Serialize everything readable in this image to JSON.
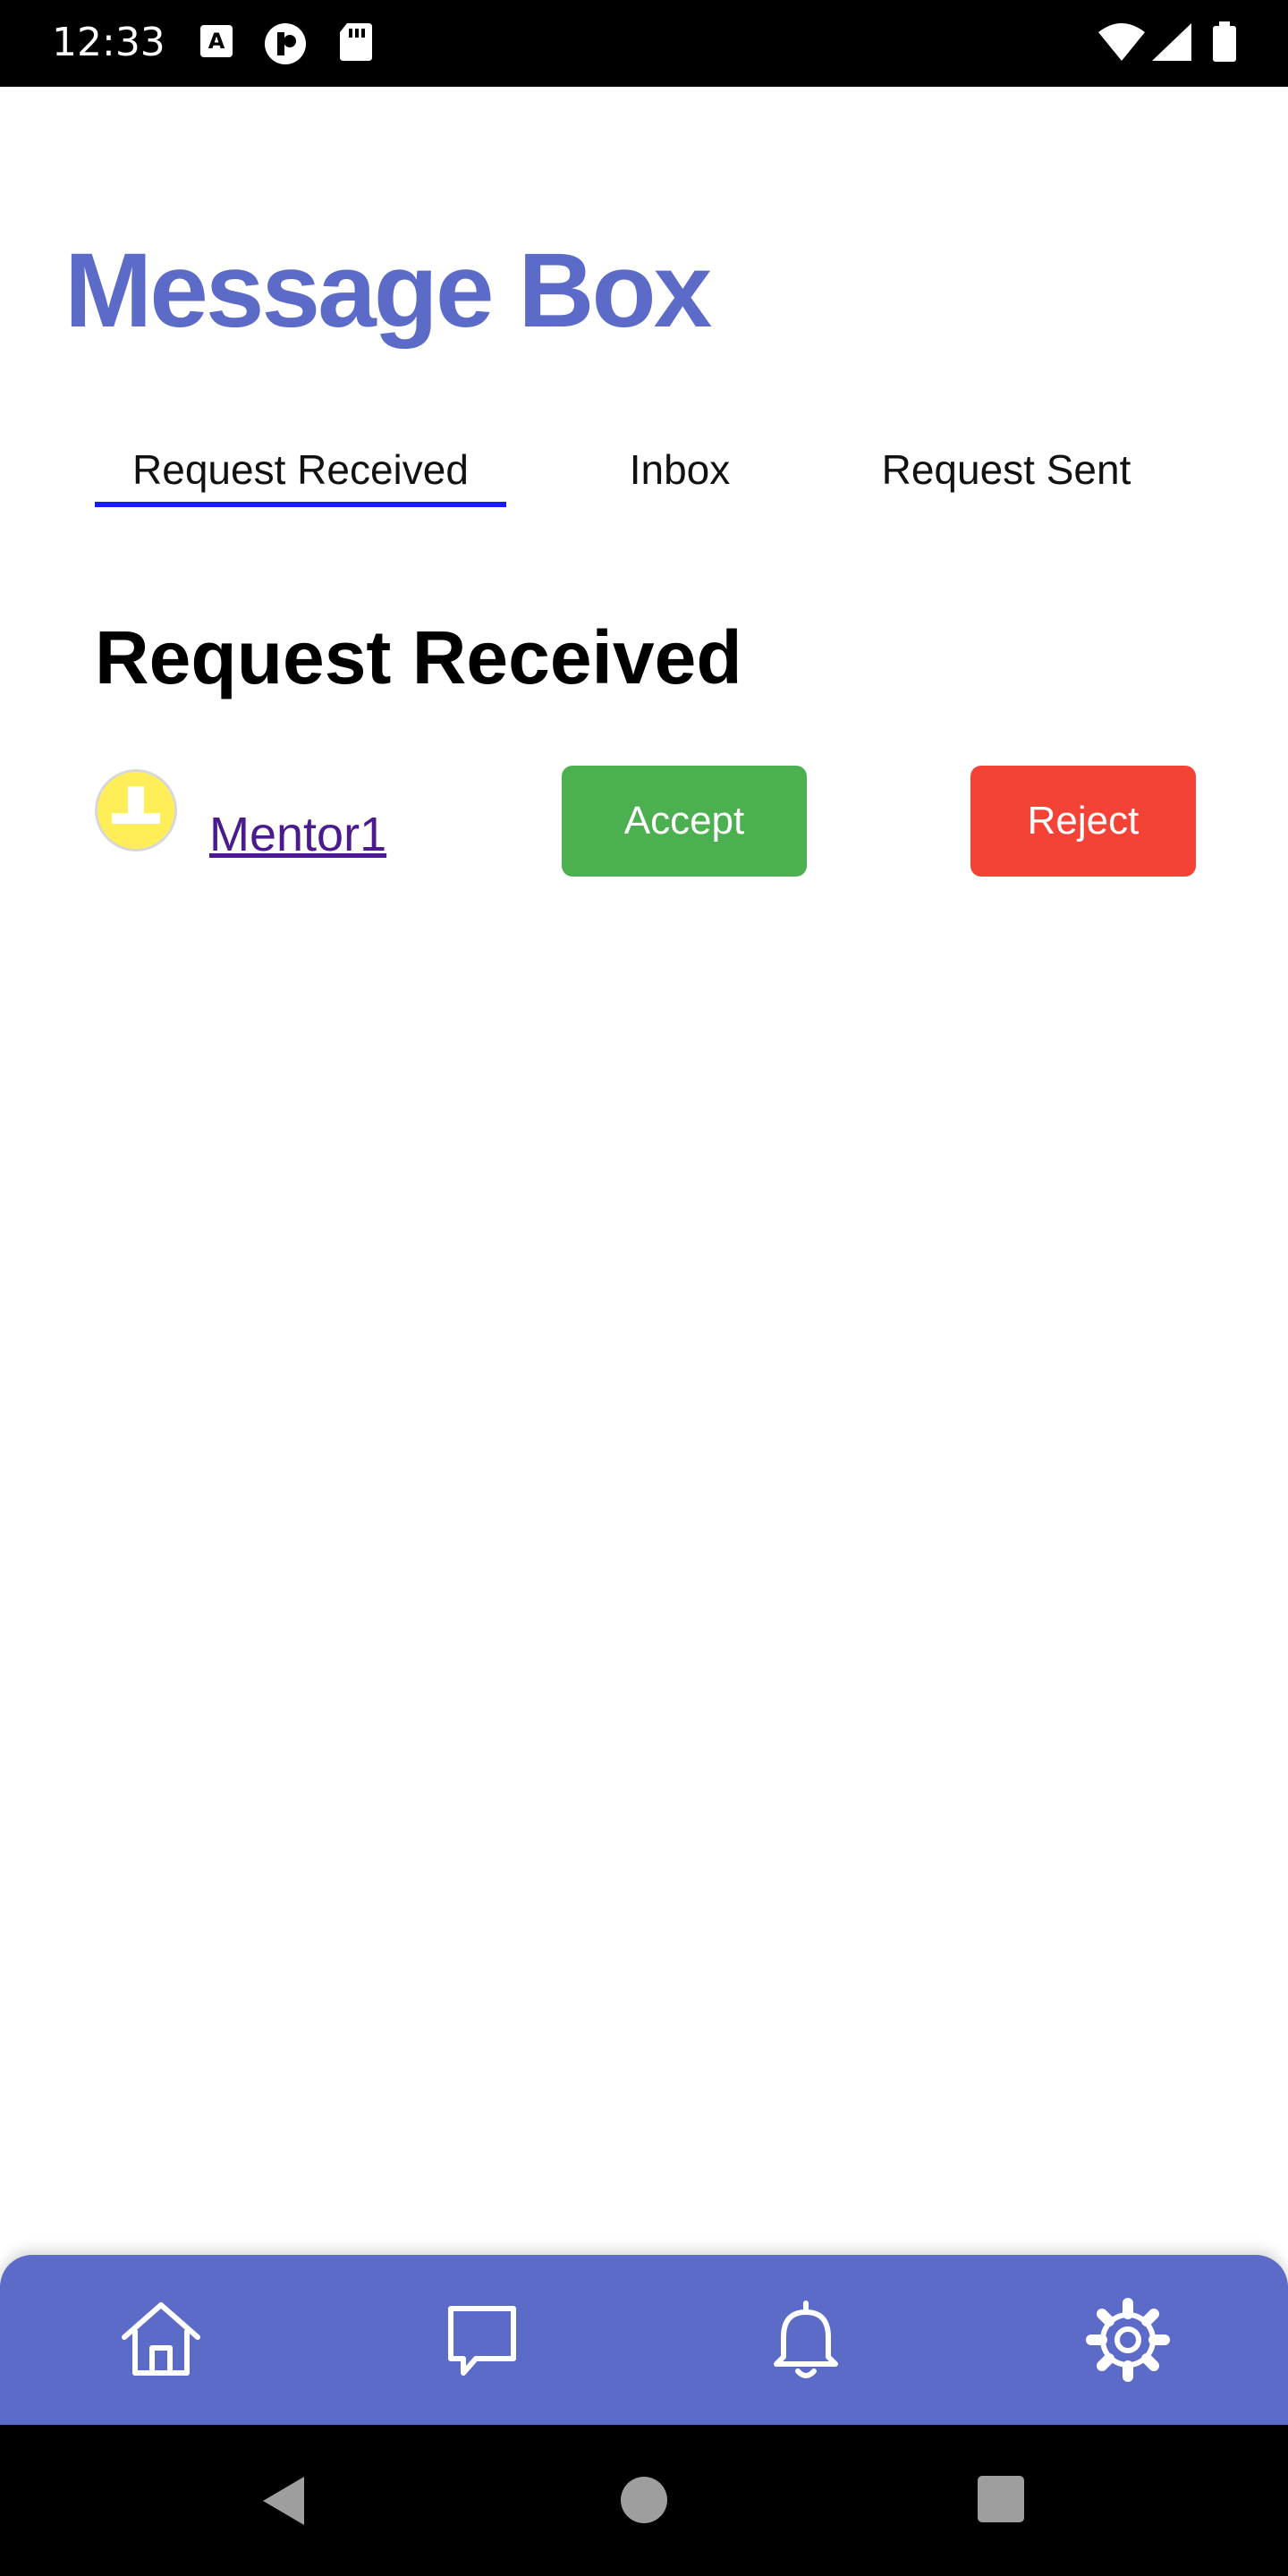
{
  "status_bar": {
    "time": "12:33",
    "left_icons": [
      "a11y-font-icon",
      "app-circle-icon",
      "sd-card-icon"
    ],
    "right_icons": [
      "wifi-icon",
      "signal-icon",
      "battery-icon"
    ]
  },
  "page": {
    "title": "Message Box"
  },
  "tabs": [
    {
      "label": "Request Received",
      "active": true
    },
    {
      "label": "Inbox",
      "active": false
    },
    {
      "label": "Request Sent",
      "active": false
    }
  ],
  "section": {
    "heading": "Request Received"
  },
  "requests": [
    {
      "name": "Mentor1",
      "accept_label": "Accept",
      "reject_label": "Reject"
    }
  ],
  "bottom_nav": {
    "items": [
      "home-icon",
      "chat-icon",
      "bell-icon",
      "gear-icon"
    ]
  },
  "system_nav": {
    "items": [
      "back-icon",
      "home-circle-icon",
      "recents-icon"
    ]
  },
  "colors": {
    "accent": "#5c6bc8",
    "tab_indicator": "#1a1aff",
    "accept": "#4caf50",
    "reject": "#f44336",
    "link": "#4b1a8c",
    "avatar_bg": "#ffee58",
    "nav_bg": "#5c6bc8"
  }
}
